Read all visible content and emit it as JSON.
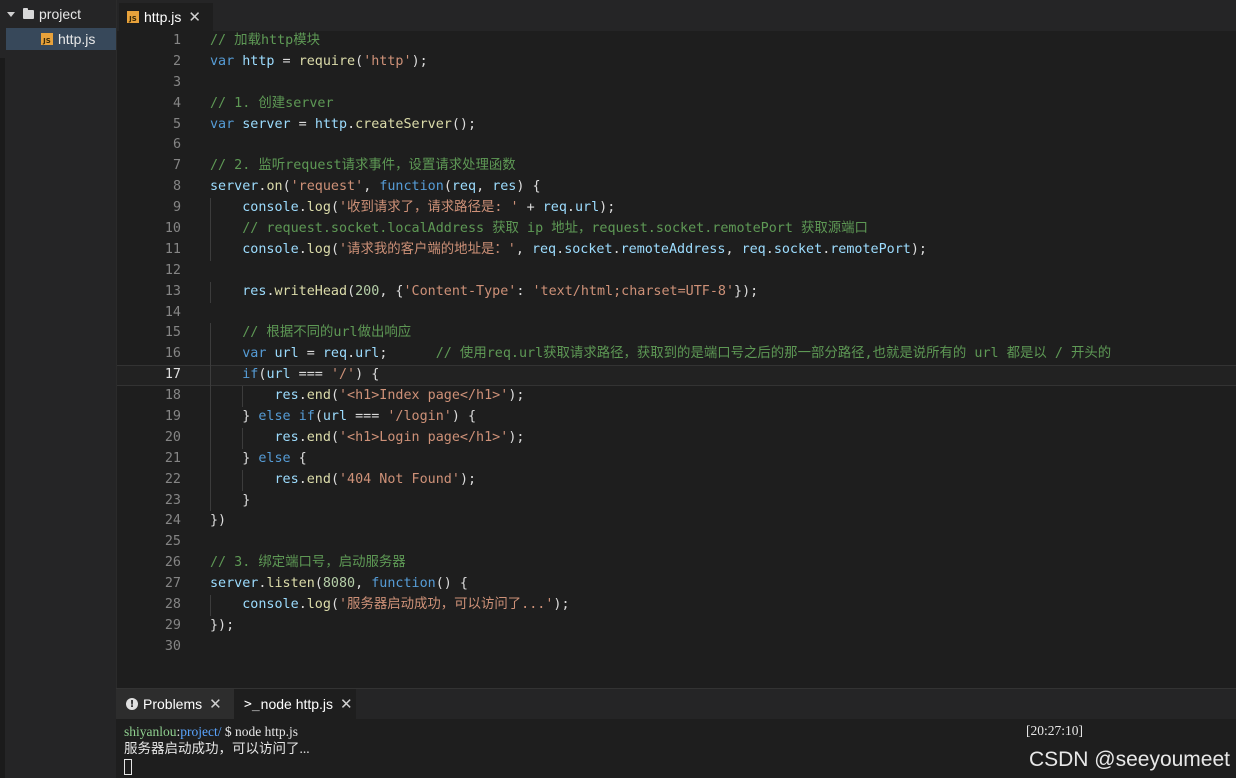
{
  "sidebar": {
    "folder_label": "project",
    "file_label": "http.js",
    "file_icon_text": "JS"
  },
  "editor": {
    "tab_label": "http.js",
    "tab_icon_text": "JS",
    "close_glyph": "✕",
    "current_line": 17
  },
  "code_lines": [
    "// 加载http模块",
    "var http = require('http');",
    "",
    "// 1. 创建server",
    "var server = http.createServer();",
    "",
    "// 2. 监听request请求事件，设置请求处理函数",
    "server.on('request', function(req, res) {",
    "    console.log('收到请求了，请求路径是: ' + req.url);",
    "    // request.socket.localAddress 获取 ip 地址，request.socket.remotePort 获取源端口",
    "    console.log('请求我的客户端的地址是：', req.socket.remoteAddress, req.socket.remotePort);",
    "",
    "    res.writeHead(200, {'Content-Type': 'text/html;charset=UTF-8'});",
    "",
    "    // 根据不同的url做出响应",
    "    var url = req.url;      // 使用req.url获取请求路径，获取到的是端口号之后的那一部分路径,也就是说所有的 url 都是以 / 开头的",
    "    if(url === '/') {",
    "        res.end('<h1>Index page</h1>');",
    "    } else if(url === '/login') {",
    "        res.end('<h1>Login page</h1>');",
    "    } else {",
    "        res.end('404 Not Found');",
    "    }",
    "})",
    "",
    "// 3. 绑定端口号，启动服务器",
    "server.listen(8080, function() {",
    "    console.log('服务器启动成功，可以访问了...');",
    "});",
    ""
  ],
  "panel": {
    "problems_label": "Problems",
    "problems_icon": "!",
    "terminal_label": "node http.js",
    "terminal_prompt_icon": ">_",
    "close_glyph": "✕",
    "terminal": {
      "user": "shiyanlou",
      "sep": ":",
      "dir": "project/",
      "command": " $ node http.js",
      "time": "[20:27:10]",
      "output": "服务器启动成功，可以访问了..."
    }
  },
  "watermark": "CSDN @seeyoumeet"
}
